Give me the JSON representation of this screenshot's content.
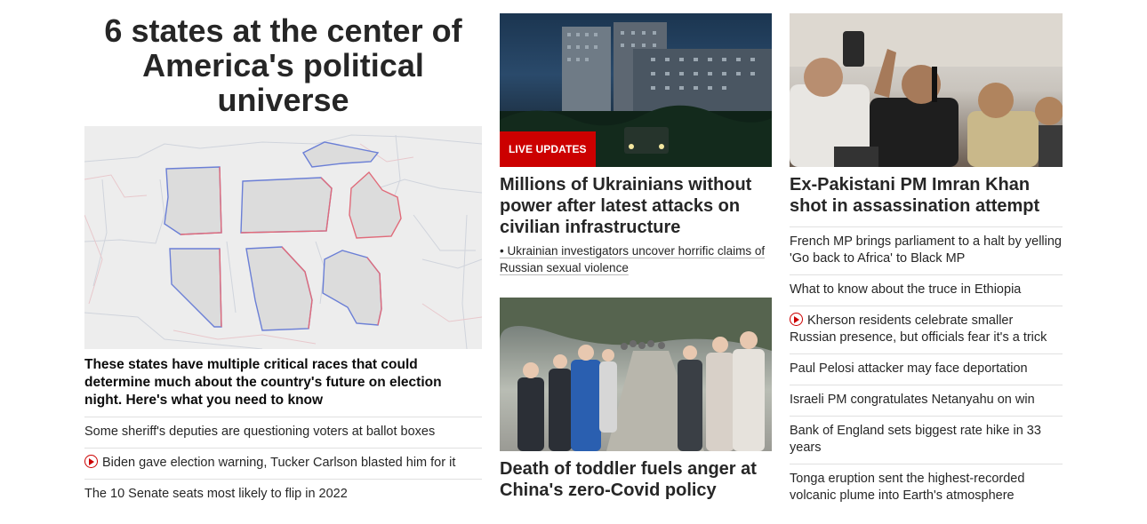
{
  "left": {
    "headline": "6 states at the center of America's political universe",
    "description": "These states have multiple critical races that could determine much about the country's future on election night. Here's what you need to know",
    "links": [
      {
        "text": "Some sheriff's deputies are questioning voters at ballot boxes",
        "video": false
      },
      {
        "text": "Biden gave election warning, Tucker Carlson blasted him for it",
        "video": true
      },
      {
        "text": "The 10 Senate seats most likely to flip in 2022",
        "video": false
      }
    ]
  },
  "middle": {
    "story1": {
      "badge": "LIVE UPDATES",
      "headline": "Millions of Ukrainians without power after latest attacks on civilian infrastructure",
      "sub_link": "• Ukrainian investigators uncover horrific claims of Russian sexual violence"
    },
    "story2": {
      "headline": "Death of toddler fuels anger at China's zero-Covid policy"
    }
  },
  "right": {
    "headline": "Ex-Pakistani PM Imran Khan shot in assassination attempt",
    "links": [
      {
        "text": "French MP brings parliament to a halt by yelling 'Go back to Africa' to Black MP",
        "video": false
      },
      {
        "text": "What to know about the truce in Ethiopia",
        "video": false
      },
      {
        "text": "Kherson residents celebrate smaller Russian presence, but officials fear it's a trick",
        "video": true
      },
      {
        "text": "Paul Pelosi attacker may face deportation",
        "video": false
      },
      {
        "text": "Israeli PM congratulates Netanyahu on win",
        "video": false
      },
      {
        "text": "Bank of England sets biggest rate hike in 33 years",
        "video": false
      },
      {
        "text": "Tonga eruption sent the highest-recorded volcanic plume into Earth's atmosphere",
        "video": false
      }
    ]
  },
  "colors": {
    "accent_red": "#cc0000",
    "text": "#262626",
    "divider": "#e0e0e0"
  },
  "icons": {
    "video": "play-circle-icon"
  }
}
